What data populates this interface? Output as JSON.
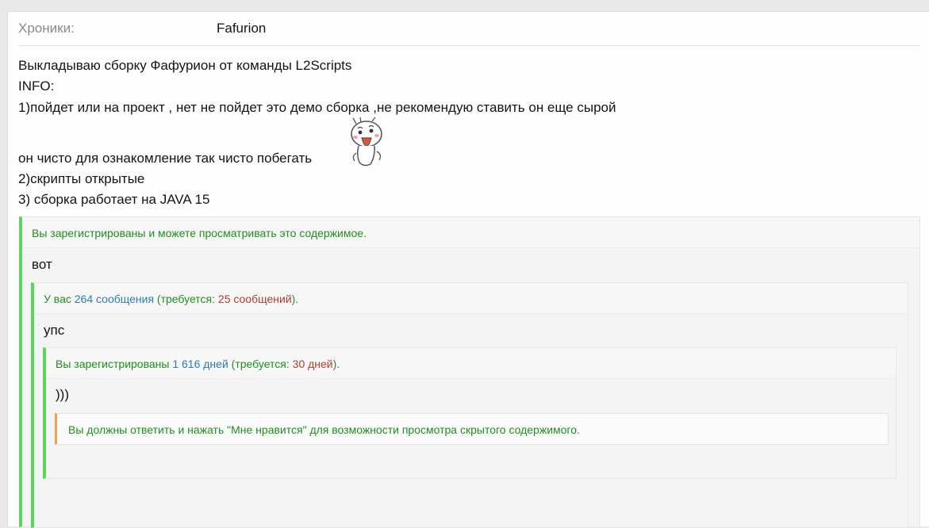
{
  "meta": {
    "label": "Хроники:",
    "value": "Fafurion"
  },
  "body_lines": [
    "Выкладываю сборку Фафурион от команды L2Scripts",
    "INFO:",
    "1)пойдет или на проект , нет не пойдет это демо сборка ,не рекомендую ставить он еще сырой",
    "он чисто для ознакомление так чисто побегать",
    "2)скрипты открытые",
    "3) сборка работает на JAVA 15"
  ],
  "hidden_1": {
    "header": "Вы зарегистрированы и можете просматривать это содержимое.",
    "content": "вот"
  },
  "hidden_2": {
    "prefix": "У вас ",
    "have": "264 сообщения",
    "mid": " (требуется: ",
    "need": "25 сообщений",
    "suffix": ").",
    "content": "упс"
  },
  "hidden_3": {
    "prefix": "Вы зарегистрированы ",
    "have": "1 616 дней",
    "mid": " (требуется: ",
    "need": "30 дней",
    "suffix": ").",
    "content": ")))"
  },
  "like_required": {
    "text": "Вы должны ответить и нажать \"Мне нравится\" для возможности просмотра скрытого содержимого."
  },
  "colors": {
    "green": "#1e8e1e",
    "accent_green": "#5ad65a",
    "blue": "#2b7bb0",
    "red": "#b03c2b",
    "orange": "#f0a050"
  },
  "emoji": {
    "icon": "laughing-face-smiley-icon"
  }
}
